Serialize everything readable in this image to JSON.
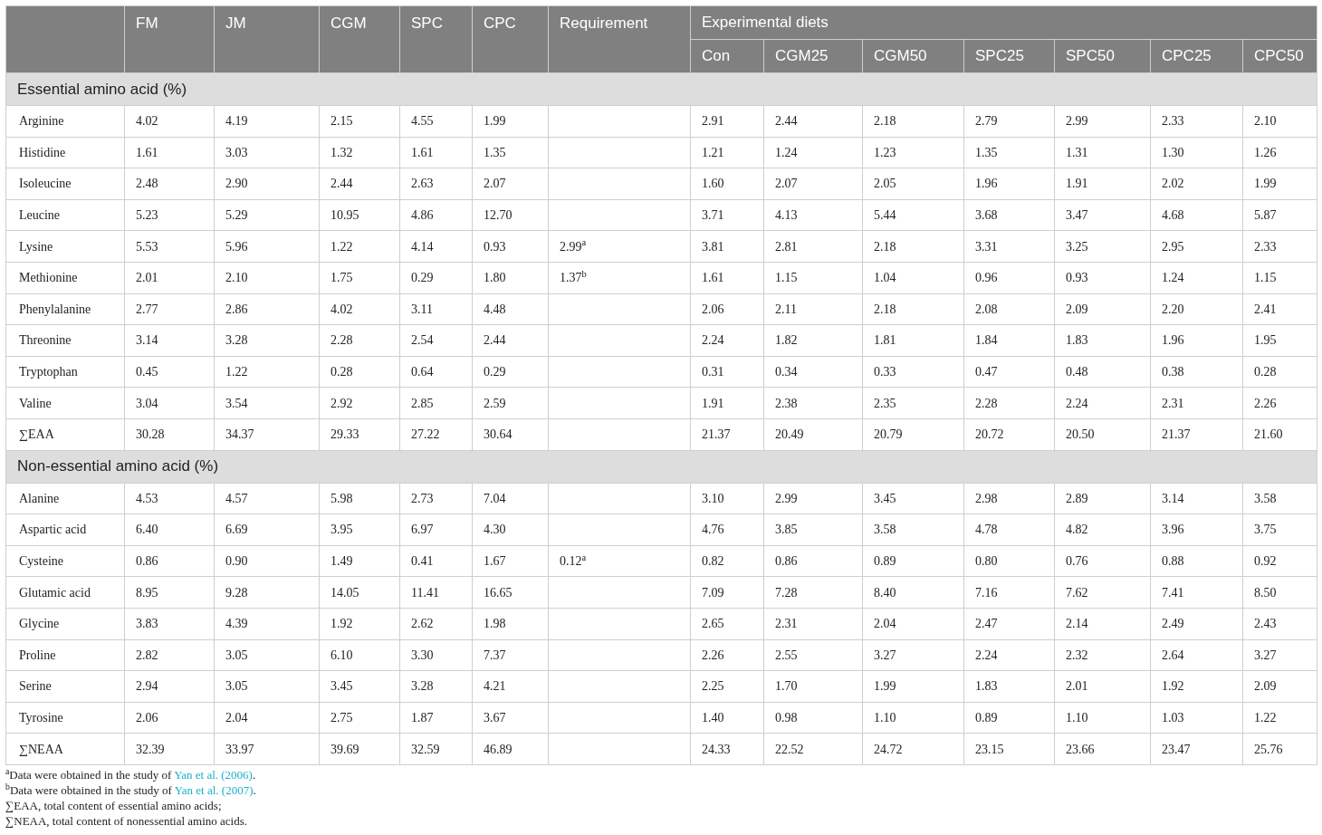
{
  "header": {
    "ingredients": [
      "FM",
      "JM",
      "CGM",
      "SPC",
      "CPC"
    ],
    "requirement": "Requirement",
    "group": "Experimental diets",
    "diets": [
      "Con",
      "CGM25",
      "CGM50",
      "SPC25",
      "SPC50",
      "CPC25",
      "CPC50"
    ]
  },
  "sections": [
    {
      "title": "Essential amino acid (%)",
      "rows": [
        {
          "name": "Arginine",
          "values": [
            "4.02",
            "4.19",
            "2.15",
            "4.55",
            "1.99"
          ],
          "diets": [
            "2.91",
            "2.44",
            "2.18",
            "2.79",
            "2.99",
            "2.33",
            "2.10"
          ]
        },
        {
          "name": "Histidine",
          "values": [
            "1.61",
            "3.03",
            "1.32",
            "1.61",
            "1.35"
          ],
          "diets": [
            "1.21",
            "1.24",
            "1.23",
            "1.35",
            "1.31",
            "1.30",
            "1.26"
          ]
        },
        {
          "name": "Isoleucine",
          "values": [
            "2.48",
            "2.90",
            "2.44",
            "2.63",
            "2.07"
          ],
          "diets": [
            "1.60",
            "2.07",
            "2.05",
            "1.96",
            "1.91",
            "2.02",
            "1.99"
          ]
        },
        {
          "name": "Leucine",
          "values": [
            "5.23",
            "5.29",
            "10.95",
            "4.86",
            "12.70"
          ],
          "diets": [
            "3.71",
            "4.13",
            "5.44",
            "3.68",
            "3.47",
            "4.68",
            "5.87"
          ]
        },
        {
          "name": "Lysine",
          "values": [
            "5.53",
            "5.96",
            "1.22",
            "4.14",
            "0.93"
          ],
          "requirement": "2.99$^{a}$",
          "diets": [
            "3.81",
            "2.81",
            "2.18",
            "3.31",
            "3.25",
            "2.95",
            "2.33"
          ]
        },
        {
          "name": "Methionine",
          "values": [
            "2.01",
            "2.10",
            "1.75",
            "0.29",
            "1.80"
          ],
          "requirement": "1.37$^{b}$",
          "diets": [
            "1.61",
            "1.15",
            "1.04",
            "0.96",
            "0.93",
            "1.24",
            "1.15"
          ]
        },
        {
          "name": "Phenylalanine",
          "values": [
            "2.77",
            "2.86",
            "4.02",
            "3.11",
            "4.48"
          ],
          "diets": [
            "2.06",
            "2.11",
            "2.18",
            "2.08",
            "2.09",
            "2.20",
            "2.41"
          ]
        },
        {
          "name": "Threonine",
          "values": [
            "3.14",
            "3.28",
            "2.28",
            "2.54",
            "2.44"
          ],
          "diets": [
            "2.24",
            "1.82",
            "1.81",
            "1.84",
            "1.83",
            "1.96",
            "1.95"
          ]
        },
        {
          "name": "Tryptophan",
          "values": [
            "0.45",
            "1.22",
            "0.28",
            "0.64",
            "0.29"
          ],
          "diets": [
            "0.31",
            "0.34",
            "0.33",
            "0.47",
            "0.48",
            "0.38",
            "0.28"
          ]
        },
        {
          "name": "Valine",
          "values": [
            "3.04",
            "3.54",
            "2.92",
            "2.85",
            "2.59"
          ],
          "diets": [
            "1.91",
            "2.38",
            "2.35",
            "2.28",
            "2.24",
            "2.31",
            "2.26"
          ]
        },
        {
          "name": "∑EAA",
          "values": [
            "30.28",
            "34.37",
            "29.33",
            "27.22",
            "30.64"
          ],
          "diets": [
            "21.37",
            "20.49",
            "20.79",
            "20.72",
            "20.50",
            "21.37",
            "21.60"
          ]
        }
      ]
    },
    {
      "title": "Non-essential amino acid (%)",
      "rows": [
        {
          "name": "Alanine",
          "values": [
            "4.53",
            "4.57",
            "5.98",
            "2.73",
            "7.04"
          ],
          "diets": [
            "3.10",
            "2.99",
            "3.45",
            "2.98",
            "2.89",
            "3.14",
            "3.58"
          ]
        },
        {
          "name": "Aspartic acid",
          "values": [
            "6.40",
            "6.69",
            "3.95",
            "6.97",
            "4.30"
          ],
          "diets": [
            "4.76",
            "3.85",
            "3.58",
            "4.78",
            "4.82",
            "3.96",
            "3.75"
          ]
        },
        {
          "name": "Cysteine",
          "values": [
            "0.86",
            "0.90",
            "1.49",
            "0.41",
            "1.67"
          ],
          "requirement": "0.12$^{a}$",
          "diets": [
            "0.82",
            "0.86",
            "0.89",
            "0.80",
            "0.76",
            "0.88",
            "0.92"
          ]
        },
        {
          "name": "Glutamic acid",
          "values": [
            "8.95",
            "9.28",
            "14.05",
            "11.41",
            "16.65"
          ],
          "diets": [
            "7.09",
            "7.28",
            "8.40",
            "7.16",
            "7.62",
            "7.41",
            "8.50"
          ]
        },
        {
          "name": "Glycine",
          "values": [
            "3.83",
            "4.39",
            "1.92",
            "2.62",
            "1.98"
          ],
          "diets": [
            "2.65",
            "2.31",
            "2.04",
            "2.47",
            "2.14",
            "2.49",
            "2.43"
          ]
        },
        {
          "name": "Proline",
          "values": [
            "2.82",
            "3.05",
            "6.10",
            "3.30",
            "7.37"
          ],
          "diets": [
            "2.26",
            "2.55",
            "3.27",
            "2.24",
            "2.32",
            "2.64",
            "3.27"
          ]
        },
        {
          "name": "Serine",
          "values": [
            "2.94",
            "3.05",
            "3.45",
            "3.28",
            "4.21"
          ],
          "diets": [
            "2.25",
            "1.70",
            "1.99",
            "1.83",
            "2.01",
            "1.92",
            "2.09"
          ]
        },
        {
          "name": "Tyrosine",
          "values": [
            "2.06",
            "2.04",
            "2.75",
            "1.87",
            "3.67"
          ],
          "diets": [
            "1.40",
            "0.98",
            "1.10",
            "0.89",
            "1.10",
            "1.03",
            "1.22"
          ]
        },
        {
          "name": "∑NEAA",
          "values": [
            "32.39",
            "33.97",
            "39.69",
            "32.59",
            "46.89"
          ],
          "diets": [
            "24.33",
            "22.52",
            "24.72",
            "23.15",
            "23.66",
            "23.47",
            "25.76"
          ]
        }
      ]
    }
  ],
  "footnotes": [
    {
      "text": "$^{a}$Data were obtained in the study of ",
      "link": "Yan et al. (2006)",
      "after": "."
    },
    {
      "text": "$^{b}$Data were obtained in the study of ",
      "link": "Yan et al. (2007)",
      "after": "."
    },
    {
      "text": "∑EAA, total content of essential amino acids;"
    },
    {
      "text": "∑NEAA, total content of nonessential amino acids."
    }
  ]
}
